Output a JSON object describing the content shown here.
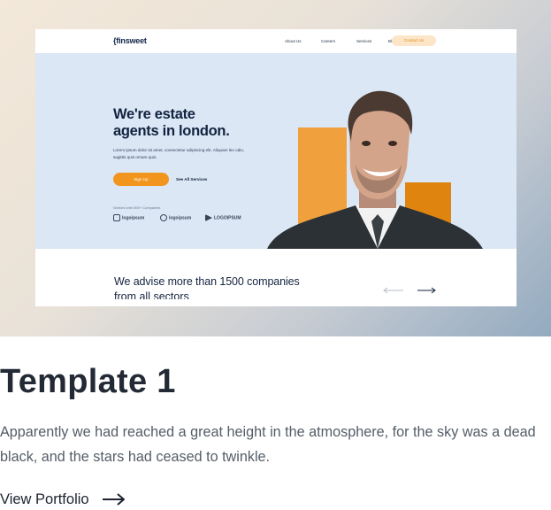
{
  "preview": {
    "nav": {
      "logo": "{finsweet",
      "links": [
        "About Us",
        "Careers",
        "Services",
        "Blog"
      ],
      "cta": "Contact Us"
    },
    "hero": {
      "heading_line1": "We're estate",
      "heading_line2": "agents in london.",
      "paragraph": "Lorem ipsum dolor sit amet, consectetur adipiscing elit. Aliquam leo odio, sagittis quis ornare quis.",
      "signup": "Sign Up",
      "see_all": "See All Services",
      "worked_with": "Worked with 500+ Companies",
      "logos": [
        "logoipsum",
        "logoipsum",
        "LOGOIPSUM"
      ]
    },
    "advise_line1": "We advise more than 1500 companies",
    "advise_line2": "from all sectors",
    "accent_color": "#f2951e",
    "hero_bg": "#dbe7f5"
  },
  "card": {
    "title": "Template 1",
    "description": "Apparently we had reached a great height in the atmosphere, for the sky was a dead black, and the stars had ceased to twinkle.",
    "link_label": "View Portfolio",
    "link_icon": "arrow-right-icon"
  }
}
